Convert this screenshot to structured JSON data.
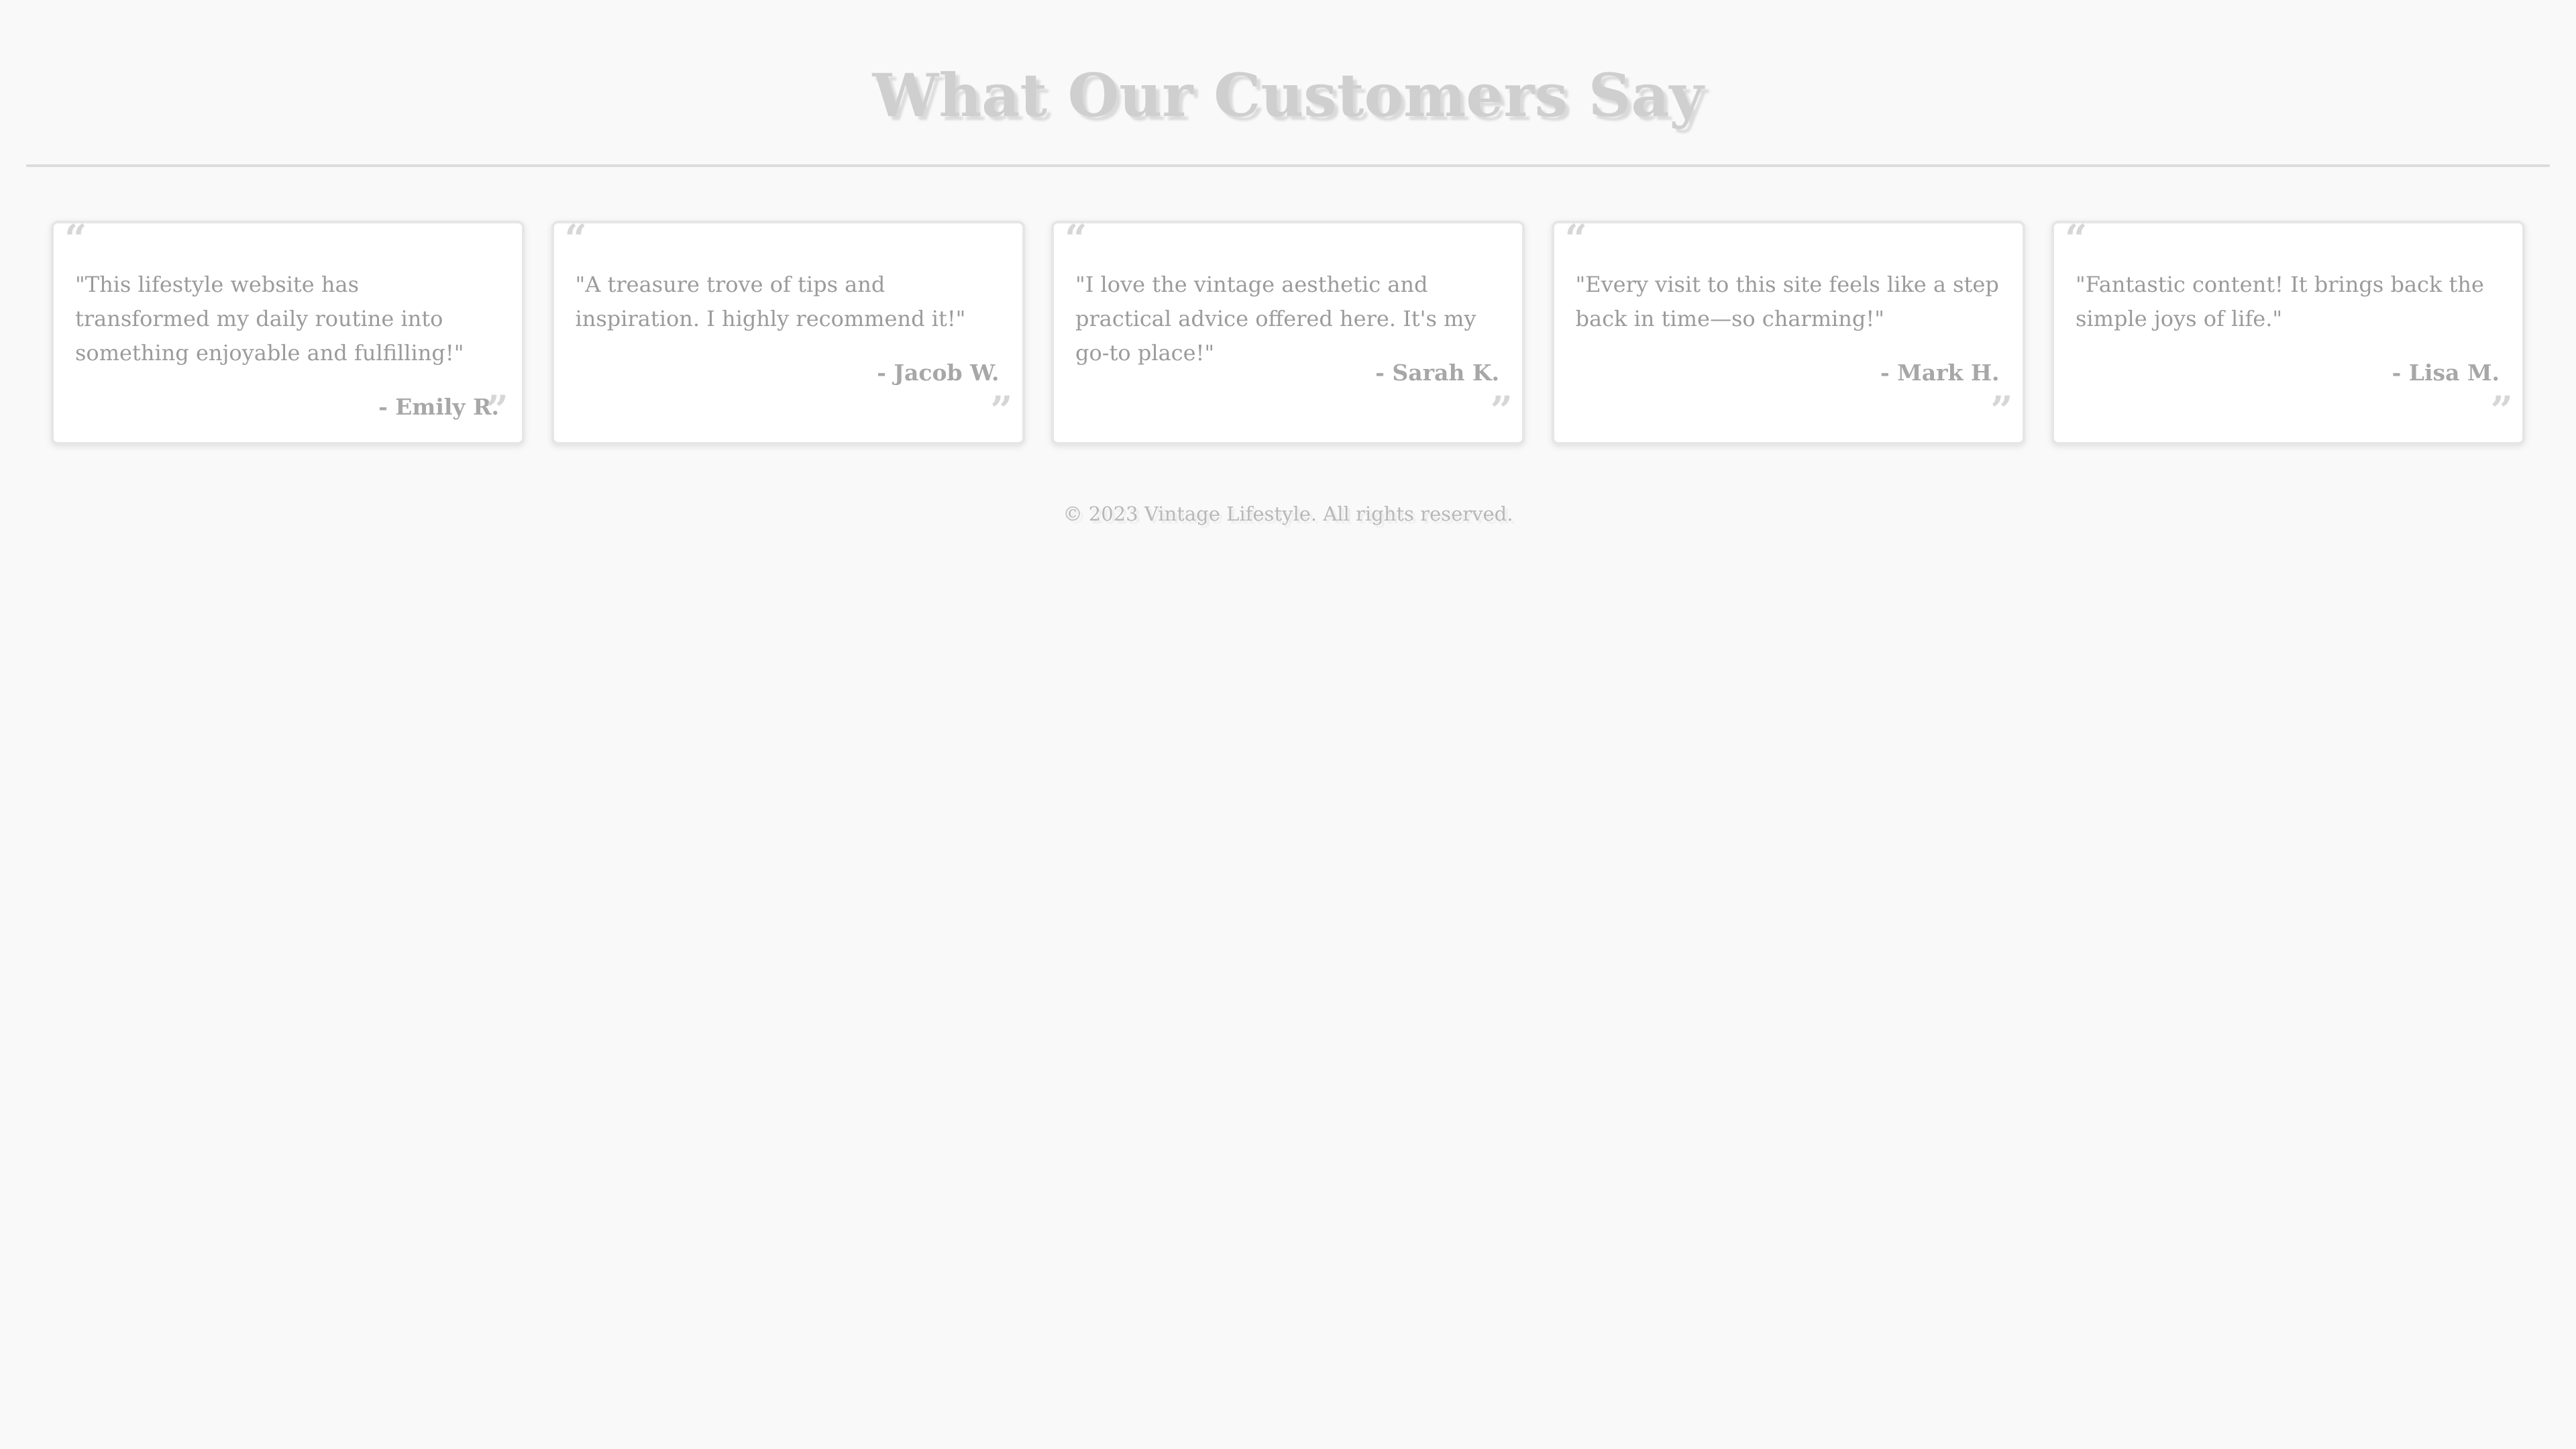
{
  "header": {
    "title": "What Our Customers Say"
  },
  "quote_glyphs": {
    "open": "“",
    "close": "”"
  },
  "testimonials": [
    {
      "text": "\"This lifestyle website has transformed my daily routine into something enjoyable and fulfilling!\"",
      "author": "- Emily R."
    },
    {
      "text": "\"A treasure trove of tips and inspiration. I highly recommend it!\"",
      "author": "- Jacob W."
    },
    {
      "text": "\"I love the vintage aesthetic and practical advice offered here. It's my go-to place!\"",
      "author": "- Sarah K."
    },
    {
      "text": "\"Every visit to this site feels like a step back in time—so charming!\"",
      "author": "- Mark H."
    },
    {
      "text": "\"Fantastic content! It brings back the simple joys of life.\"",
      "author": "- Lisa M."
    }
  ],
  "footer": {
    "copyright": "© 2023 Vintage Lifestyle. All rights reserved."
  },
  "colors": {
    "background": "#f9f9f9",
    "card_background": "#ffffff",
    "title_text": "#cfcfcf",
    "body_text": "#9b9b9b"
  }
}
